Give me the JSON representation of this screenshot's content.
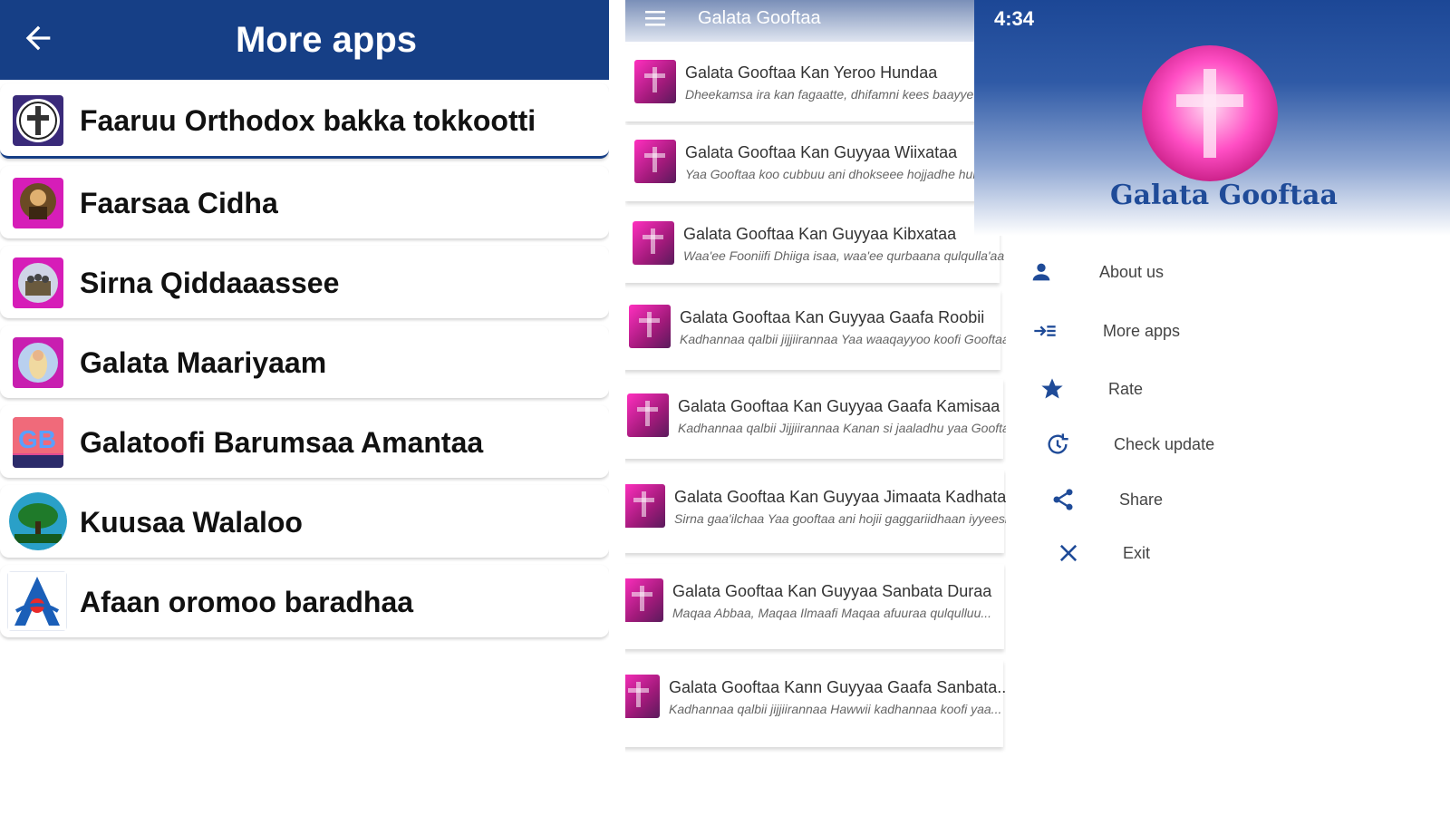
{
  "more_apps": {
    "title": "More apps",
    "apps": [
      {
        "label": "Faaruu Orthodox bakka tokkootti",
        "icon": "orthodox-cross-icon"
      },
      {
        "label": "Faarsaa Cidha",
        "icon": "saint-icon"
      },
      {
        "label": "Sirna Qiddaaassee",
        "icon": "church-icon"
      },
      {
        "label": "Galata Maariyaam",
        "icon": "mary-icon"
      },
      {
        "label": "Galatoofi Barumsaa Amantaa",
        "icon": "gb-logo-icon"
      },
      {
        "label": "Kuusaa Walaloo",
        "icon": "tree-icon"
      },
      {
        "label": "Afaan oromoo baradhaa",
        "icon": "letter-a-icon"
      }
    ]
  },
  "song_list": {
    "title": "Galata Gooftaa",
    "items": [
      {
        "title": "Galata Gooftaa Kan Yeroo Hundaa",
        "subtitle": "Dheekamsa ira kan fagaatte, dhifamni kees baayye"
      },
      {
        "title": "Galata Gooftaa Kan Guyyaa Wiixataa",
        "subtitle": "Yaa Gooftaa koo cubbuu ani dhokseee hojjadhe hunduma"
      },
      {
        "title": "Galata Gooftaa Kan Guyyaa Kibxataa",
        "subtitle": "Waa'ee Fooniifi Dhiiga isaa, waa'ee qurbaana qulqulla'aa"
      },
      {
        "title": "Galata Gooftaa Kan Guyyaa Gaafa Roobii",
        "subtitle": "Kadhannaa qalbii jijjiirannaa Yaa waaqayyoo koofi Gooftaa"
      },
      {
        "title": "Galata Gooftaa Kan Guyyaa Gaafa Kamisaa",
        "subtitle": "Kadhannaa qalbii Jijjiirannaa Kanan si jaaladhu yaa Gooftaa"
      },
      {
        "title": "Galata Gooftaa Kan Guyyaa Jimaata Kadhata...",
        "subtitle": "Sirna gaa'ilchaa Yaa gooftaa ani hojii gaggariidhaan iyyeesis..."
      },
      {
        "title": "Galata Gooftaa Kan Guyyaa Sanbata Duraa",
        "subtitle": "Maqaa Abbaa, Maqaa Ilmaafi Maqaa afuuraa qulqulluu..."
      },
      {
        "title": "Galata Gooftaa Kann Guyyaa Gaafa Sanbata...",
        "subtitle": "Kadhannaa qalbii jijjiirannaa Hawwii kadhannaa koofi yaa..."
      }
    ]
  },
  "drawer": {
    "time": "4:34",
    "app_name": "Galata Gooftaa",
    "items": [
      {
        "label": "About us",
        "icon": "person-icon"
      },
      {
        "label": "More apps",
        "icon": "more-apps-icon"
      },
      {
        "label": "Rate",
        "icon": "star-icon"
      },
      {
        "label": "Check update",
        "icon": "update-icon"
      },
      {
        "label": "Share",
        "icon": "share-icon"
      },
      {
        "label": "Exit",
        "icon": "close-icon"
      }
    ]
  },
  "colors": {
    "header_blue": "#163f86",
    "accent_blue": "#1f4b98",
    "pink": "#ff4ec4"
  }
}
